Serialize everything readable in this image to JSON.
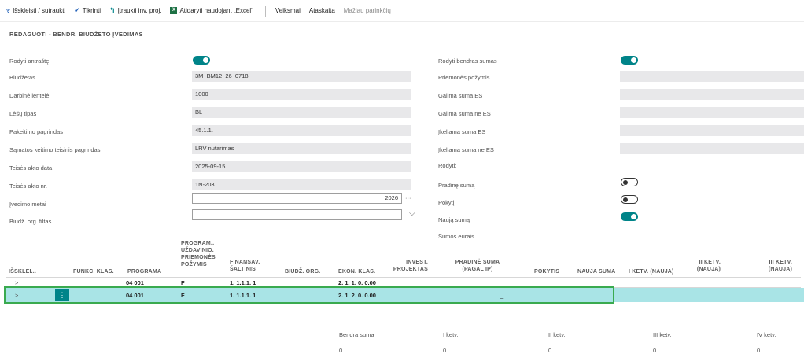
{
  "toolbar": {
    "expand": "Išskleisti / sutraukti",
    "check": "Tikrinti",
    "insert_inv": "Įtraukti inv. proj.",
    "excel": "Atidaryti naudojant „Excel“",
    "excel_glyph": "X",
    "actions": "Veiksmai",
    "report": "Ataskaita",
    "fewer": "Mažiau parinkčių"
  },
  "page": {
    "title": "REDAGUOTI - BENDR. BIUDŽETO ĮVEDIMAS"
  },
  "left_fields": {
    "show_header": {
      "label": "Rodyti antraštę",
      "on": true
    },
    "budget": {
      "label": "Biudžetas",
      "value": "3M_BM12_26_0718"
    },
    "worksheet": {
      "label": "Darbinė lentelė",
      "value": "1000"
    },
    "funds_type": {
      "label": "Lėšų tipas",
      "value": "BL"
    },
    "change_basis": {
      "label": "Pakeitimo pagrindas",
      "value": "45.1.1."
    },
    "estimate_legal_basis": {
      "label": "Sąmatos keitimo teisinis pagrindas",
      "value": "LRV nutarimas"
    },
    "act_date": {
      "label": "Teisės akto data",
      "value": "2025-09-15"
    },
    "act_no": {
      "label": "Teisės akto nr.",
      "value": "1N-203"
    },
    "entry_year": {
      "label": "Įvedimo metai",
      "value": "2026",
      "lookup": "···"
    },
    "org_filter": {
      "label": "Biudž. org. filtas",
      "value": "",
      "chevron": "⌵"
    }
  },
  "right_fields": {
    "show_totals": {
      "label": "Rodyti bendras sumas",
      "on": true
    },
    "measure_attr": {
      "label": "Priemonės požymis",
      "value": ""
    },
    "avail_es": {
      "label": "Galima suma ES",
      "value": ""
    },
    "avail_non_es": {
      "label": "Galima suma ne ES",
      "value": ""
    },
    "insert_es": {
      "label": "Įkeliama suma ES",
      "value": ""
    },
    "insert_non_es": {
      "label": "Įkeliama suma ne ES",
      "value": ""
    },
    "show": {
      "label": "Rodyti:"
    },
    "initial": {
      "label": "Pradinę sumą",
      "on": false
    },
    "change": {
      "label": "Pokytį",
      "on": false
    },
    "new": {
      "label": "Naują sumą",
      "on": true
    },
    "amounts_eur": {
      "label": "Sumos eurais"
    }
  },
  "grid": {
    "headers": {
      "expand": "IŠSKLEI...",
      "func": "FUNKC. KLAS.",
      "program": "PROGRAMA",
      "measure_l1": "PROGRAM..",
      "measure_l2": "UŽDAVINIO.",
      "measure_l3": "PRIEMONĖS",
      "measure_l4": "POŽYMIS",
      "source_l1": "FINANSAV.",
      "source_l2": "ŠALTINIS",
      "org": "BIUDŽ. ORG.",
      "econ": "EKON. KLAS.",
      "invest_l1": "INVEST.",
      "invest_l2": "PROJEKTAS",
      "initial_l1": "PRADINĖ SUMA",
      "initial_l2": "(PAGAL IP)",
      "change": "POKYTIS",
      "new": "NAUJA SUMA",
      "q1": "I KETV. (NAUJA)",
      "q2_l1": "II KETV.",
      "q2_l2": "(NAUJA)",
      "q3_l1": "III KETV.",
      "q3_l2": "(NAUJA)"
    },
    "rows": [
      {
        "expand": ">",
        "program": "04 001",
        "measure": "F",
        "source": "1. 1.1.1. 1",
        "econ": "2. 1. 1. 0. 0.00",
        "initial": ""
      },
      {
        "expand": ">",
        "program": "04 001",
        "measure": "F",
        "source": "1. 1.1.1. 1",
        "econ": "2. 1. 2. 0. 0.00",
        "initial": "_"
      }
    ],
    "row_menu": "⋮"
  },
  "totals": {
    "headers": {
      "total": "Bendra suma",
      "q1": "I ketv.",
      "q2": "II ketv.",
      "q3": "III ketv.",
      "q4": "IV ketv."
    },
    "values": {
      "total": "0",
      "q1": "0",
      "q2": "0",
      "q3": "0",
      "q4": "0"
    }
  },
  "colors": {
    "accent": "#008489",
    "selection": "#a9e4e6",
    "highlight_outline": "#3aaa4f",
    "excel": "#1e7145"
  }
}
